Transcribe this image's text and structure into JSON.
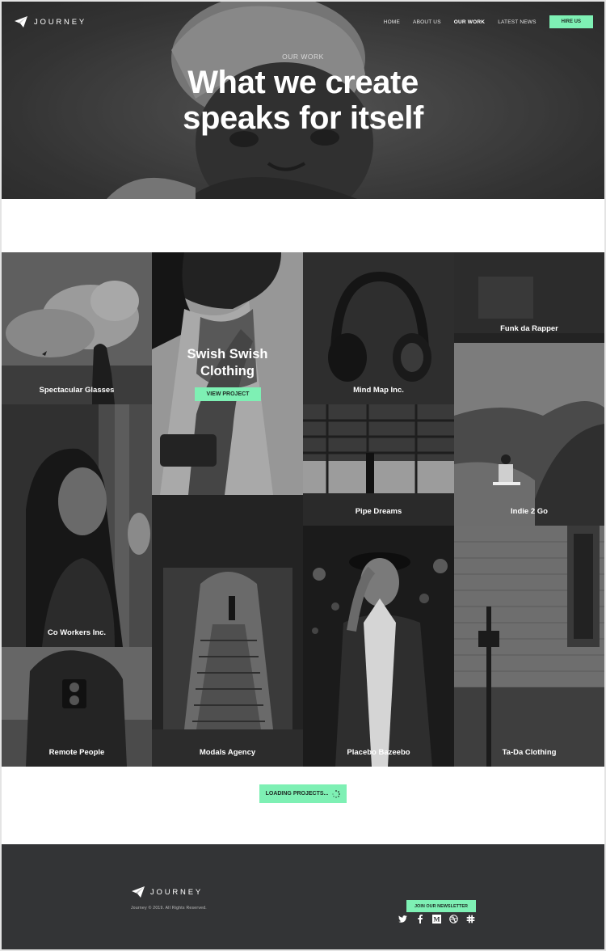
{
  "brand": {
    "name": "JOURNEY",
    "logo_icon": "paper-plane-icon"
  },
  "nav": {
    "items": [
      {
        "label": "HOME"
      },
      {
        "label": "ABOUT US"
      },
      {
        "label": "OUR WORK",
        "active": true
      },
      {
        "label": "LATEST NEWS"
      }
    ],
    "cta_label": "HIRE US"
  },
  "hero": {
    "eyebrow": "OUR WORK",
    "title_line1": "What we create",
    "title_line2": "speaks for itself"
  },
  "projects": [
    {
      "name": "Spectacular Glasses"
    },
    {
      "name": "Co Workers Inc."
    },
    {
      "name": "Remote People"
    },
    {
      "name": "Swish Swish Clothing",
      "featured": true,
      "title_line1": "Swish Swish",
      "title_line2": "Clothing",
      "cta_label": "VIEW PROJECT"
    },
    {
      "name": "Modals Agency"
    },
    {
      "name": "Mind Map Inc."
    },
    {
      "name": "Pipe Dreams"
    },
    {
      "name": "Placebo Bazeebo"
    },
    {
      "name": "Funk da Rapper"
    },
    {
      "name": "Indie 2 Go"
    },
    {
      "name": "Ta-Da Clothing"
    }
  ],
  "loading": {
    "label": "LOADING PROJECTS...",
    "icon": "spinner-icon"
  },
  "footer": {
    "brand": "JOURNEY",
    "copyright": "Journey © 2019. All Rights Reserved.",
    "socials": [
      "twitter-icon",
      "facebook-icon",
      "medium-icon",
      "dribbble-icon",
      "slack-icon"
    ],
    "newsletter_label": "JOIN OUR NEWSLETTER"
  },
  "colors": {
    "accent": "#7ef0b4",
    "footer_bg": "#333436",
    "tile_dark": "#2a2a2a"
  }
}
